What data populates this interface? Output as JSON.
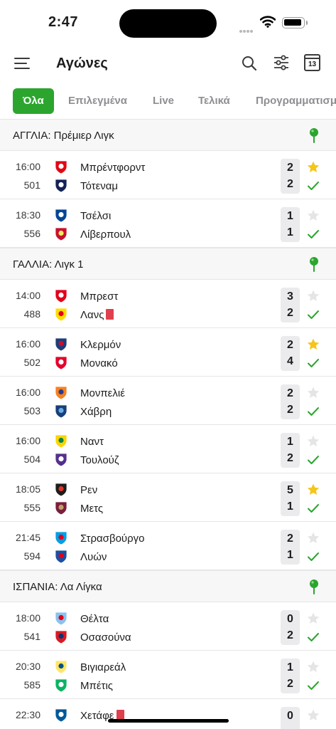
{
  "status": {
    "time": "2:47"
  },
  "header": {
    "title": "Αγώνες",
    "calendar_day": "13"
  },
  "tabs": [
    {
      "label": "Όλα",
      "active": true
    },
    {
      "label": "Επιλεγμένα"
    },
    {
      "label": "Live"
    },
    {
      "label": "Τελικά"
    },
    {
      "label": "Προγραμματισμένα"
    }
  ],
  "colors": {
    "accent": "#2ca52e",
    "star": "#f5c518",
    "check": "#2ca52e",
    "red_card": "#e0404d"
  },
  "leagues": [
    {
      "name": "ΑΓΓΛΙΑ: Πρέμιερ Λιγκ",
      "matches": [
        {
          "time": "16:00",
          "code": "501",
          "home": "Μπρέντφορντ",
          "away": "Τότεναμ",
          "home_score": "2",
          "away_score": "2",
          "starred": true,
          "home_icon": "brentford-crest-icon",
          "away_icon": "tottenham-crest-icon"
        },
        {
          "time": "18:30",
          "code": "556",
          "home": "Τσέλσι",
          "away": "Λίβερπουλ",
          "home_score": "1",
          "away_score": "1",
          "starred": false,
          "home_icon": "chelsea-crest-icon",
          "away_icon": "liverpool-crest-icon"
        }
      ]
    },
    {
      "name": "ΓΑΛΛΙΑ: Λιγκ 1",
      "matches": [
        {
          "time": "14:00",
          "code": "488",
          "home": "Μπρεστ",
          "away": "Λανς",
          "home_score": "3",
          "away_score": "2",
          "starred": false,
          "away_red_card": true,
          "home_icon": "brest-crest-icon",
          "away_icon": "lens-crest-icon"
        },
        {
          "time": "16:00",
          "code": "502",
          "home": "Κλερμόν",
          "away": "Μονακό",
          "home_score": "2",
          "away_score": "4",
          "starred": true,
          "home_icon": "clermont-crest-icon",
          "away_icon": "monaco-crest-icon"
        },
        {
          "time": "16:00",
          "code": "503",
          "home": "Μονπελιέ",
          "away": "Χάβρη",
          "home_score": "2",
          "away_score": "2",
          "starred": false,
          "home_icon": "montpellier-crest-icon",
          "away_icon": "le-havre-crest-icon"
        },
        {
          "time": "16:00",
          "code": "504",
          "home": "Ναντ",
          "away": "Τουλούζ",
          "home_score": "1",
          "away_score": "2",
          "starred": false,
          "home_icon": "nantes-crest-icon",
          "away_icon": "toulouse-crest-icon"
        },
        {
          "time": "18:05",
          "code": "555",
          "home": "Ρεν",
          "away": "Μετς",
          "home_score": "5",
          "away_score": "1",
          "starred": true,
          "home_icon": "rennes-crest-icon",
          "away_icon": "metz-crest-icon"
        },
        {
          "time": "21:45",
          "code": "594",
          "home": "Στρασβούργο",
          "away": "Λυών",
          "home_score": "2",
          "away_score": "1",
          "starred": false,
          "home_icon": "strasbourg-crest-icon",
          "away_icon": "lyon-crest-icon"
        }
      ]
    },
    {
      "name": "ΙΣΠΑΝΙΑ: Λα Λίγκα",
      "matches": [
        {
          "time": "18:00",
          "code": "541",
          "home": "Θέλτα",
          "away": "Οσασούνα",
          "home_score": "0",
          "away_score": "2",
          "starred": false,
          "home_icon": "celta-crest-icon",
          "away_icon": "osasuna-crest-icon"
        },
        {
          "time": "20:30",
          "code": "585",
          "home": "Βιγιαρεάλ",
          "away": "Μπέτις",
          "home_score": "1",
          "away_score": "2",
          "starred": false,
          "home_icon": "villarreal-crest-icon",
          "away_icon": "betis-crest-icon"
        },
        {
          "time": "22:30",
          "code": "",
          "home": "Χετάφε",
          "away": "",
          "home_score": "0",
          "away_score": "",
          "starred": false,
          "home_red_card": true,
          "home_icon": "getafe-crest-icon",
          "away_icon": ""
        }
      ]
    }
  ]
}
